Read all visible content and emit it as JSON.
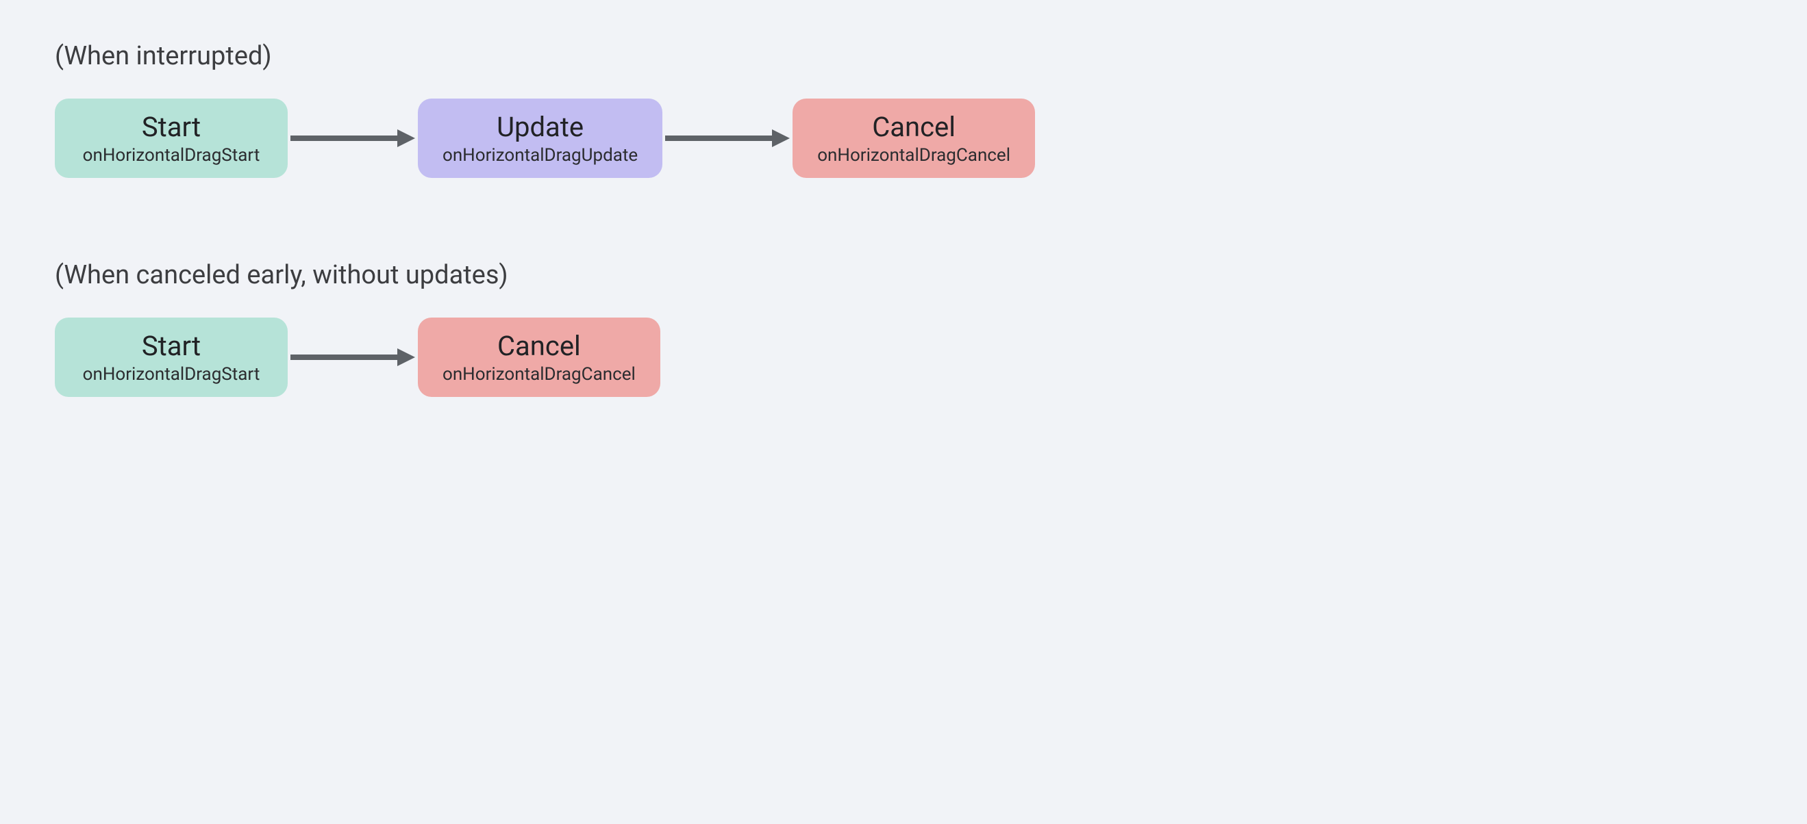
{
  "colors": {
    "teal": "#b6e3d8",
    "purple": "#c2bdf2",
    "red": "#efa9a7",
    "arrow": "#5e6267",
    "bg": "#f1f3f7"
  },
  "sections": [
    {
      "label": "(When interrupted)",
      "nodes": [
        {
          "title": "Start",
          "sub": "onHorizontalDragStart",
          "color": "teal"
        },
        {
          "title": "Update",
          "sub": "onHorizontalDragUpdate",
          "color": "purple"
        },
        {
          "title": "Cancel",
          "sub": "onHorizontalDragCancel",
          "color": "red"
        }
      ]
    },
    {
      "label": "(When canceled early, without updates)",
      "nodes": [
        {
          "title": "Start",
          "sub": "onHorizontalDragStart",
          "color": "teal"
        },
        {
          "title": "Cancel",
          "sub": "onHorizontalDragCancel",
          "color": "red"
        }
      ]
    }
  ]
}
